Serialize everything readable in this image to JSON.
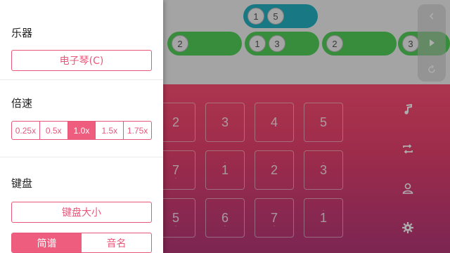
{
  "score": {
    "bars": [
      {
        "notes": [
          {
            "n": "1",
            "dot": ""
          },
          {
            "n": "5",
            "dot": ""
          }
        ],
        "color": "teal"
      },
      {
        "notes": [
          {
            "n": "2",
            "dot": "·"
          }
        ],
        "color": "green"
      },
      {
        "notes": [
          {
            "n": "1",
            "dot": ""
          },
          {
            "n": "3",
            "dot": ""
          }
        ],
        "color": "green"
      },
      {
        "notes": [
          {
            "n": "2",
            "dot": ""
          }
        ],
        "color": "green"
      },
      {
        "notes": [
          {
            "n": "3",
            "dot": ""
          }
        ],
        "color": "green"
      }
    ]
  },
  "keyboard": {
    "row1": [
      "2",
      "3",
      "4",
      "5"
    ],
    "row2": [
      {
        "n": "7",
        "mark": "below"
      },
      {
        "n": "1",
        "mark": "above"
      },
      {
        "n": "2",
        "mark": "above"
      },
      {
        "n": "3",
        "mark": "above"
      }
    ],
    "row3": [
      {
        "n": "5",
        "mark": "below"
      },
      {
        "n": "6",
        "mark": "below"
      },
      {
        "n": "7",
        "mark": "below"
      },
      {
        "n": "1",
        "mark": "above"
      }
    ]
  },
  "rail": {
    "icons": [
      "chevron-left-icon",
      "play-icon",
      "refresh-icon"
    ]
  },
  "side_controls": {
    "icons": [
      "music-note-icon",
      "repeat-icon",
      "user-icon",
      "settings-gear-icon"
    ]
  },
  "drawer": {
    "instrument": {
      "title": "乐器",
      "value": "电子琴(C)"
    },
    "speed": {
      "title": "倍速",
      "options": [
        "0.25x",
        "0.5x",
        "1.0x",
        "1.5x",
        "1.75x"
      ],
      "selected": "1.0x"
    },
    "keyboard": {
      "title": "键盘",
      "size_button": "键盘大小",
      "modes": [
        "简谱",
        "音名"
      ],
      "selected_mode": "简谱"
    }
  },
  "colors": {
    "accent": "#ee5c7e",
    "green": "#53d05a",
    "teal": "#24b3c3"
  }
}
